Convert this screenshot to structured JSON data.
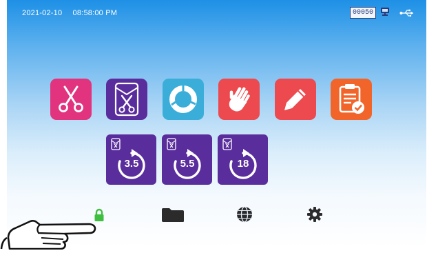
{
  "status_bar": {
    "date": "2021-02-10",
    "time": "08:58:00 PM",
    "counter": "00050",
    "icons": [
      "monitor-icon",
      "usb-icon"
    ]
  },
  "top_tiles": [
    {
      "name": "scissors-program",
      "icon": "scissors-icon",
      "color": "#e2337e"
    },
    {
      "name": "pouched-scissors-program",
      "icon": "pouched-scissors-icon",
      "color": "#5a2d9c"
    },
    {
      "name": "cycle-program",
      "icon": "ring-cycle-icon",
      "color": "#3aaed9"
    },
    {
      "name": "glove-program",
      "icon": "glove-icon",
      "color": "#ec4a4f"
    },
    {
      "name": "edit-program",
      "icon": "pencil-icon",
      "color": "#ec4a4f"
    },
    {
      "name": "report-program",
      "icon": "clipboard-check-icon",
      "color": "#f2652a"
    }
  ],
  "program_tiles": [
    {
      "label": "3.5",
      "icon": "pouch-timer-icon"
    },
    {
      "label": "5.5",
      "icon": "pouch-timer-icon"
    },
    {
      "label": "18",
      "icon": "pouch-timer-icon"
    }
  ],
  "bottom_bar": [
    {
      "name": "lock",
      "icon": "lock-icon",
      "color": "#3fbf3f"
    },
    {
      "name": "folder",
      "icon": "folder-icon",
      "color": "#2b2b2b"
    },
    {
      "name": "language",
      "icon": "globe-icon",
      "color": "#2b2b2b"
    },
    {
      "name": "settings",
      "icon": "gear-icon",
      "color": "#2b2b2b"
    }
  ],
  "pointer": {
    "icon": "pointing-hand-icon"
  }
}
